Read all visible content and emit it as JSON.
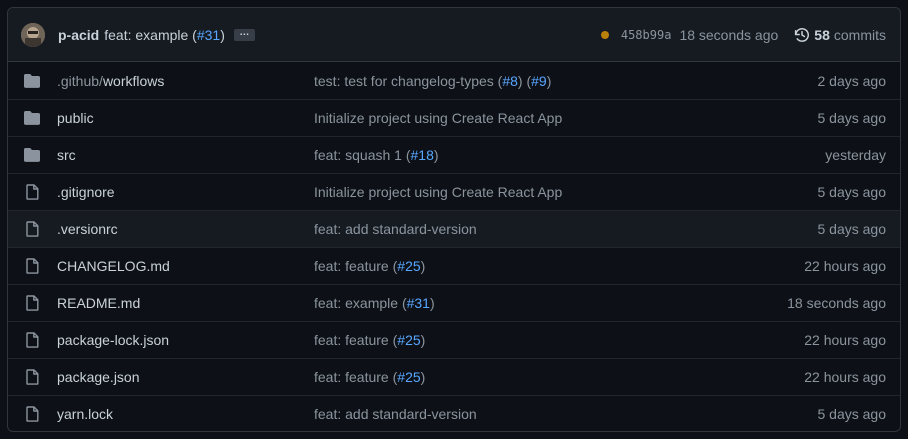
{
  "latest_commit": {
    "author": "p-acid",
    "message_prefix": "feat: example (",
    "pr": "#31",
    "message_suffix": ")",
    "ellipsis": "…",
    "sha": "458b99a",
    "time": "18 seconds ago",
    "status_color": "#bb8009",
    "history_icon": "history-icon",
    "commit_count": "58",
    "commit_label": "commits"
  },
  "files": [
    {
      "type": "directory",
      "name_dim": ".github/",
      "name": "workflows",
      "commit": [
        {
          "t": "test: test for changelog-types ("
        },
        {
          "t": "#8",
          "link": true
        },
        {
          "t": ") ("
        },
        {
          "t": "#9",
          "link": true
        },
        {
          "t": ")"
        }
      ],
      "age": "2 days ago"
    },
    {
      "type": "directory",
      "name_dim": "",
      "name": "public",
      "commit": [
        {
          "t": "Initialize project using Create React App"
        }
      ],
      "age": "5 days ago"
    },
    {
      "type": "directory",
      "name_dim": "",
      "name": "src",
      "commit": [
        {
          "t": "feat: squash 1 ("
        },
        {
          "t": "#18",
          "link": true
        },
        {
          "t": ")"
        }
      ],
      "age": "yesterday"
    },
    {
      "type": "file",
      "name_dim": "",
      "name": ".gitignore",
      "commit": [
        {
          "t": "Initialize project using Create React App"
        }
      ],
      "age": "5 days ago"
    },
    {
      "type": "file",
      "name_dim": "",
      "name": ".versionrc",
      "commit": [
        {
          "t": "feat: add standard-version"
        }
      ],
      "age": "5 days ago",
      "highlight": true
    },
    {
      "type": "file",
      "name_dim": "",
      "name": "CHANGELOG.md",
      "commit": [
        {
          "t": "feat: feature ("
        },
        {
          "t": "#25",
          "link": true
        },
        {
          "t": ")"
        }
      ],
      "age": "22 hours ago"
    },
    {
      "type": "file",
      "name_dim": "",
      "name": "README.md",
      "commit": [
        {
          "t": "feat: example ("
        },
        {
          "t": "#31",
          "link": true
        },
        {
          "t": ")"
        }
      ],
      "age": "18 seconds ago"
    },
    {
      "type": "file",
      "name_dim": "",
      "name": "package-lock.json",
      "commit": [
        {
          "t": "feat: feature ("
        },
        {
          "t": "#25",
          "link": true
        },
        {
          "t": ")"
        }
      ],
      "age": "22 hours ago"
    },
    {
      "type": "file",
      "name_dim": "",
      "name": "package.json",
      "commit": [
        {
          "t": "feat: feature ("
        },
        {
          "t": "#25",
          "link": true
        },
        {
          "t": ")"
        }
      ],
      "age": "22 hours ago"
    },
    {
      "type": "file",
      "name_dim": "",
      "name": "yarn.lock",
      "commit": [
        {
          "t": "feat: add standard-version"
        }
      ],
      "age": "5 days ago"
    }
  ],
  "colors": {
    "background": "#0d1117",
    "header": "#161b22",
    "border": "#30363d",
    "link": "#58a6ff",
    "muted": "#8b949e",
    "folder": "#8b949e"
  }
}
